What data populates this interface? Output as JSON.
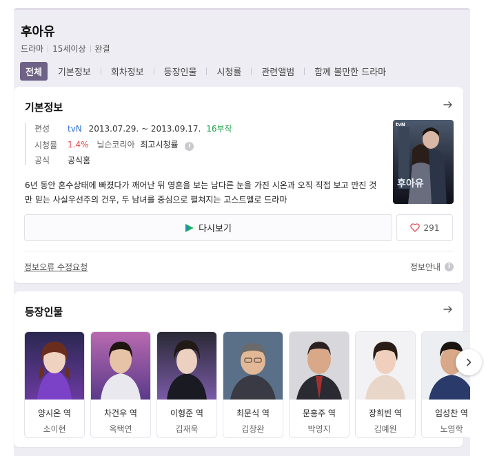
{
  "header": {
    "title": "후아유",
    "meta": [
      "드라마",
      "15세이상",
      "완결"
    ]
  },
  "tabs": [
    {
      "label": "전체",
      "active": true
    },
    {
      "label": "기본정보"
    },
    {
      "label": "회차정보"
    },
    {
      "label": "등장인물"
    },
    {
      "label": "시청률"
    },
    {
      "label": "관련앨범"
    },
    {
      "label": "함께 볼만한 드라마"
    }
  ],
  "basic_info": {
    "title": "기본정보",
    "broadcast_label": "편성",
    "channel": "tvN",
    "period": "2013.07.29. ~ 2013.09.17.",
    "episodes": "16부작",
    "rating_label": "시청률",
    "rating_value": "1.4%",
    "rating_source": "닐슨코리아",
    "rating_note": "최고시청률",
    "official_label": "공식",
    "official_link": "공식홈",
    "description": "6년 동안 혼수상태에 빠졌다가 깨어난 뒤 영혼을 보는 남다른 눈을 가진 시온과 오직 직접 보고 만진 것만 믿는 사실우선주의 건우, 두 남녀를 중심으로 펼쳐지는 고스트멜로 드라마",
    "poster_text": "후아유",
    "poster_channel": "tvN",
    "replay_label": "다시보기",
    "like_count": "291",
    "report_label": "정보오류 수정요청",
    "guide_label": "정보안내"
  },
  "cast": {
    "title": "등장인물",
    "members": [
      {
        "role": "양시온 역",
        "actor": "소이현"
      },
      {
        "role": "차건우 역",
        "actor": "옥택연"
      },
      {
        "role": "이형준 역",
        "actor": "김재욱"
      },
      {
        "role": "최문식 역",
        "actor": "김창완"
      },
      {
        "role": "문홍주 역",
        "actor": "박영지"
      },
      {
        "role": "장희빈 역",
        "actor": "김예원"
      },
      {
        "role": "임성찬 역",
        "actor": "노영학"
      }
    ]
  },
  "colors": {
    "accent": "#6e6286",
    "channel_blue": "#2e6fd1",
    "episodes_green": "#1aa44a",
    "rating_red": "#e5484d"
  },
  "icons": [
    "arrow-right-icon",
    "info-icon",
    "play-logo-icon",
    "heart-icon",
    "chevron-right-icon"
  ]
}
